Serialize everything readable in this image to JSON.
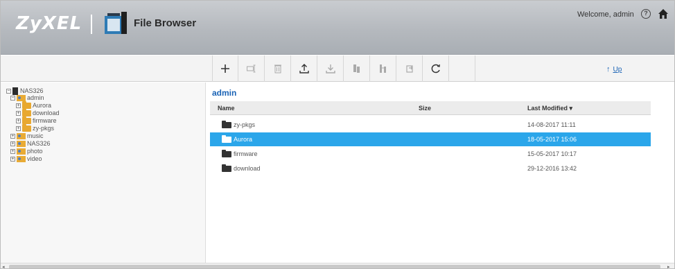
{
  "header": {
    "brand": "ZyXEL",
    "app_title": "File Browser",
    "welcome": "Welcome, admin",
    "help_icon": "?",
    "colors": {
      "header_bg": "#b5b9be",
      "link": "#1a63b5",
      "selected_row": "#2ba6ea"
    }
  },
  "toolbar": {
    "buttons": [
      {
        "icon": "add-icon"
      },
      {
        "icon": "rename-icon"
      },
      {
        "icon": "delete-icon"
      },
      {
        "icon": "upload-icon"
      },
      {
        "icon": "download-icon"
      },
      {
        "icon": "copy-icon"
      },
      {
        "icon": "move-icon"
      },
      {
        "icon": "share-icon"
      },
      {
        "icon": "refresh-icon"
      }
    ],
    "up_label": "Up"
  },
  "tree": {
    "items": [
      {
        "label": "NAS326",
        "expander": "−",
        "type": "nas"
      },
      {
        "label": "admin",
        "expander": "−",
        "type": "share"
      },
      {
        "label": "Aurora",
        "expander": "+",
        "type": "folder"
      },
      {
        "label": "download",
        "expander": "+",
        "type": "folder"
      },
      {
        "label": "firmware",
        "expander": "+",
        "type": "folder"
      },
      {
        "label": "zy-pkgs",
        "expander": "+",
        "type": "folder"
      },
      {
        "label": "music",
        "expander": "+",
        "type": "share"
      },
      {
        "label": "NAS326",
        "expander": "+",
        "type": "share"
      },
      {
        "label": "photo",
        "expander": "+",
        "type": "share"
      },
      {
        "label": "video",
        "expander": "+",
        "type": "share"
      }
    ]
  },
  "main": {
    "breadcrumb": "admin",
    "columns": {
      "name": "Name",
      "size": "Size",
      "modified": "Last Modified ▾"
    },
    "rows": [
      {
        "name": "zy-pkgs",
        "size": "",
        "modified": "14-08-2017 11:11",
        "selected": false
      },
      {
        "name": "Aurora",
        "size": "",
        "modified": "18-05-2017 15:06",
        "selected": true
      },
      {
        "name": "firmware",
        "size": "",
        "modified": "15-05-2017 10:17",
        "selected": false
      },
      {
        "name": "download",
        "size": "",
        "modified": "29-12-2016 13:42",
        "selected": false
      }
    ]
  }
}
